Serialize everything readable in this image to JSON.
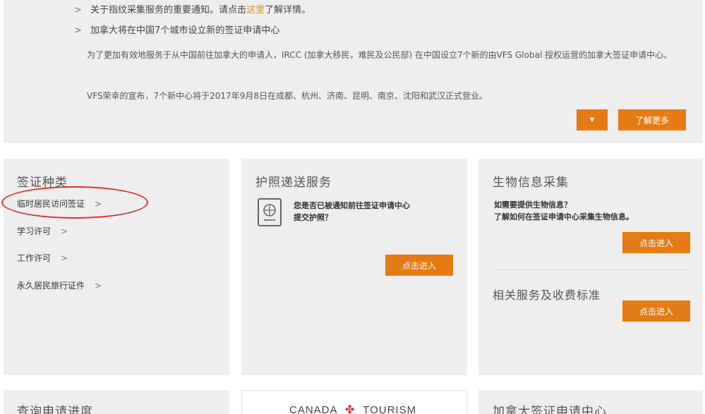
{
  "notice": {
    "item1_text": "关于指纹采集服务的重要通知。请点击",
    "item1_link": "这里",
    "item1_suffix": "了解详情。",
    "item2_text": "加拿大将在中国7个城市设立新的签证申请中心",
    "para1": "为了更加有效地服务于从中国前往加拿大的申请人，IRCC (加拿大移民，难民及公民部) 在中国设立7个新的由VFS Global 授权运营的加拿大签证申请中心。",
    "para2": "VFS荣幸的宣布，7个新中心将于2017年9月8日在成都、杭州、济南、昆明、南京、沈阳和武汉正式营业。",
    "toggle_symbol": "▼",
    "learn_more": "了解更多"
  },
  "visa_types": {
    "title": "签证种类",
    "items": [
      {
        "label": "临时居民访问签证"
      },
      {
        "label": "学习许可"
      },
      {
        "label": "工作许可"
      },
      {
        "label": "永久居民旅行证件"
      }
    ]
  },
  "passport": {
    "title": "护照递送服务",
    "desc_line1": "您是否已被通知前往签证申请中心",
    "desc_line2": "提交护照？",
    "button": "点击进入"
  },
  "biometrics": {
    "title": "生物信息采集",
    "q_line1": "如需要提供生物信息？",
    "q_line2": "了解如何在签证申请中心采集生物信息。",
    "button": "点击进入",
    "fees_title": "相关服务及收费标准",
    "fees_button": "点击进入"
  },
  "bottom": {
    "left_title": "查询申请进度",
    "mid_logo_left": "CANADA",
    "mid_logo_right": "TOURISM",
    "right_title": "加拿大签证申请中心"
  },
  "colors": {
    "accent": "#e47b14",
    "card_bg": "#eeeeee",
    "circle": "#d9332b"
  }
}
